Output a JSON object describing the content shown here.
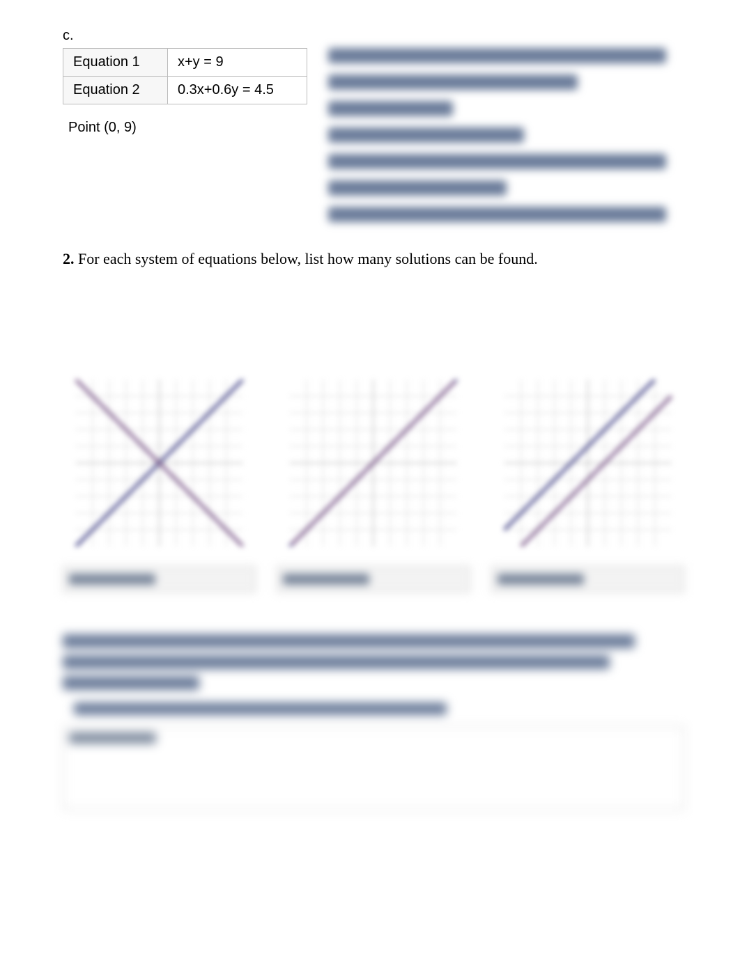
{
  "part_c": {
    "label": "c.",
    "rows": [
      {
        "label": "Equation 1",
        "value": "x+y = 9"
      },
      {
        "label": "Equation 2",
        "value": "0.3x+0.6y = 4.5"
      }
    ],
    "point": "Point (0, 9)"
  },
  "q2": {
    "number": "2.",
    "text": "For each system of equations below, list how many solutions can be found."
  },
  "chart_data": [
    {
      "type": "line",
      "title": "",
      "xlabel": "",
      "ylabel": "",
      "xlim": [
        -5,
        5
      ],
      "ylim": [
        -5,
        5
      ],
      "grid": true,
      "description": "two intersecting lines (one solution)",
      "series": [
        {
          "name": "line-a",
          "points": [
            [
              -5,
              -5
            ],
            [
              5,
              5
            ]
          ]
        },
        {
          "name": "line-b",
          "points": [
            [
              -5,
              5
            ],
            [
              5,
              -5
            ]
          ]
        }
      ]
    },
    {
      "type": "line",
      "title": "",
      "xlabel": "",
      "ylabel": "",
      "xlim": [
        -5,
        5
      ],
      "ylim": [
        -5,
        5
      ],
      "grid": true,
      "description": "two coincident lines (infinite solutions)",
      "series": [
        {
          "name": "line-a",
          "points": [
            [
              -5,
              -5
            ],
            [
              5,
              5
            ]
          ]
        },
        {
          "name": "line-b",
          "points": [
            [
              -5,
              -5
            ],
            [
              5,
              5
            ]
          ]
        }
      ]
    },
    {
      "type": "line",
      "title": "",
      "xlabel": "",
      "ylabel": "",
      "xlim": [
        -5,
        5
      ],
      "ylim": [
        -5,
        5
      ],
      "grid": true,
      "description": "two parallel lines (no solution)",
      "series": [
        {
          "name": "line-a",
          "points": [
            [
              -5,
              -4
            ],
            [
              5,
              6
            ]
          ]
        },
        {
          "name": "line-b",
          "points": [
            [
              -5,
              -6
            ],
            [
              5,
              4
            ]
          ]
        }
      ]
    }
  ],
  "answers_row": [
    {
      "placeholder": ""
    },
    {
      "placeholder": ""
    },
    {
      "placeholder": ""
    }
  ]
}
